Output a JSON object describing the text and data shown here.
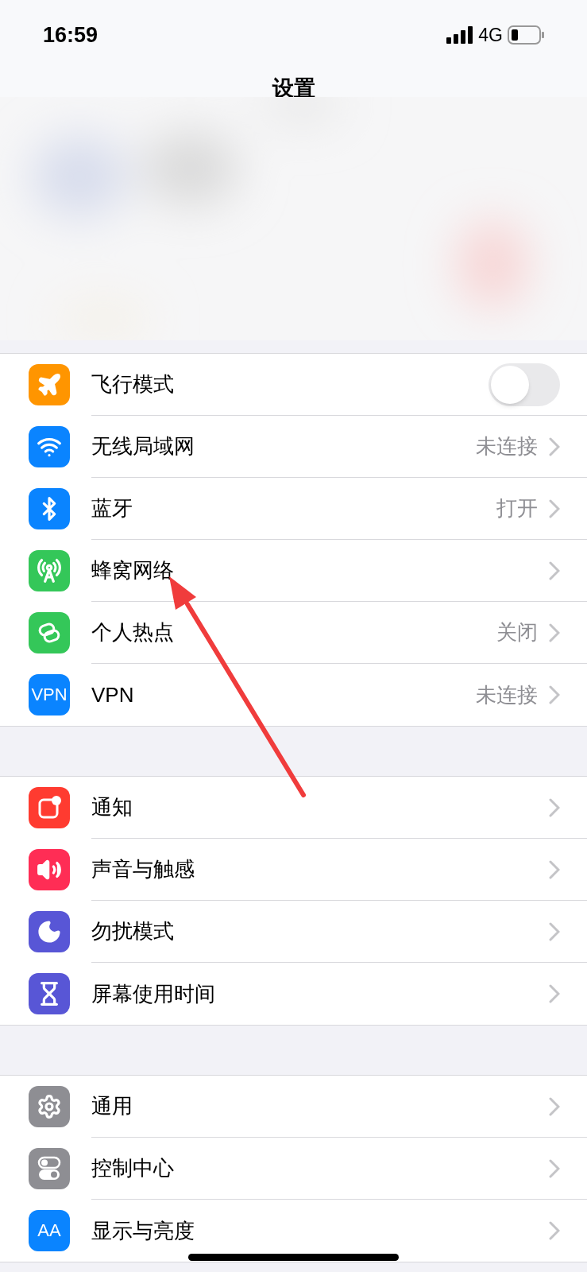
{
  "status_bar": {
    "time": "16:59",
    "network": "4G"
  },
  "title": "设置",
  "groups": [
    {
      "rows": [
        {
          "kind": "toggle",
          "color": "#ff9500",
          "label": "飞行模式",
          "on": false
        },
        {
          "kind": "link",
          "color": "#0a84ff",
          "label": "无线局域网",
          "value": "未连接"
        },
        {
          "kind": "link",
          "color": "#0a84ff",
          "label": "蓝牙",
          "value": "打开"
        },
        {
          "kind": "link",
          "color": "#34c759",
          "label": "蜂窝网络"
        },
        {
          "kind": "link",
          "color": "#34c759",
          "label": "个人热点",
          "value": "关闭"
        },
        {
          "kind": "link",
          "icon_text": "VPN",
          "color": "#0a84ff",
          "label": "VPN",
          "value": "未连接"
        }
      ]
    },
    {
      "rows": [
        {
          "kind": "link",
          "color": "#ff3b30",
          "label": "通知"
        },
        {
          "kind": "link",
          "color": "#ff2d55",
          "label": "声音与触感"
        },
        {
          "kind": "link",
          "color": "#5856d6",
          "label": "勿扰模式"
        },
        {
          "kind": "link",
          "color": "#5856d6",
          "label": "屏幕使用时间"
        }
      ]
    },
    {
      "rows": [
        {
          "kind": "link",
          "color": "#8e8e93",
          "label": "通用"
        },
        {
          "kind": "link",
          "color": "#8e8e93",
          "label": "控制中心"
        },
        {
          "kind": "link",
          "icon_text": "AA",
          "color": "#0a84ff",
          "label": "显示与亮度"
        }
      ]
    }
  ]
}
